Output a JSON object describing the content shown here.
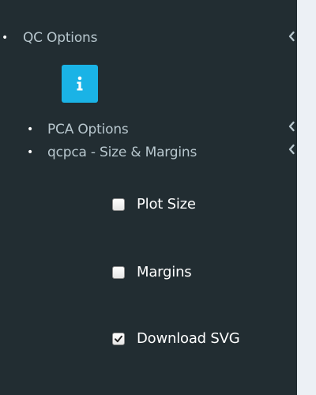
{
  "sidebar": {
    "menu": [
      {
        "label": "QC Options",
        "bullet": "•",
        "icon": "chevron-left-icon"
      },
      {
        "label": "PCA Options",
        "bullet": "•",
        "icon": "chevron-left-icon"
      },
      {
        "label": "qcpca - Size & Margins",
        "bullet": "•",
        "icon": "chevron-left-icon"
      }
    ],
    "info_button": {
      "icon": "info-icon",
      "color": "#1ab3e6"
    },
    "checkboxes": [
      {
        "label": "Plot Size",
        "checked": false
      },
      {
        "label": "Margins",
        "checked": false
      },
      {
        "label": "Download SVG",
        "checked": true
      }
    ]
  },
  "colors": {
    "sidebar_bg": "#222d32",
    "menu_text": "#b8c7ce",
    "checkbox_text": "#ffffff",
    "content_bg": "#ecf0f5"
  }
}
